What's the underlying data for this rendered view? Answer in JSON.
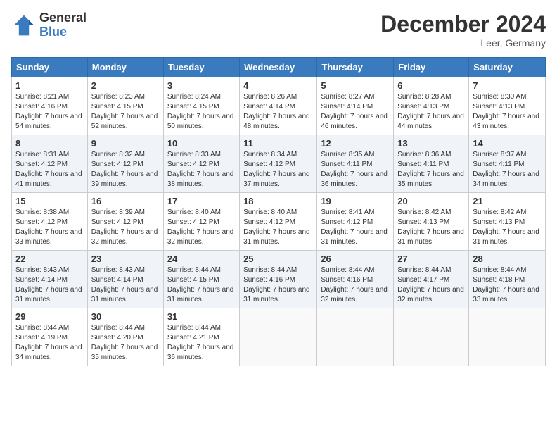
{
  "header": {
    "logo_line1": "General",
    "logo_line2": "Blue",
    "month": "December 2024",
    "location": "Leer, Germany"
  },
  "weekdays": [
    "Sunday",
    "Monday",
    "Tuesday",
    "Wednesday",
    "Thursday",
    "Friday",
    "Saturday"
  ],
  "weeks": [
    [
      {
        "day": "1",
        "sunrise": "8:21 AM",
        "sunset": "4:16 PM",
        "daylight": "7 hours and 54 minutes."
      },
      {
        "day": "2",
        "sunrise": "8:23 AM",
        "sunset": "4:15 PM",
        "daylight": "7 hours and 52 minutes."
      },
      {
        "day": "3",
        "sunrise": "8:24 AM",
        "sunset": "4:15 PM",
        "daylight": "7 hours and 50 minutes."
      },
      {
        "day": "4",
        "sunrise": "8:26 AM",
        "sunset": "4:14 PM",
        "daylight": "7 hours and 48 minutes."
      },
      {
        "day": "5",
        "sunrise": "8:27 AM",
        "sunset": "4:14 PM",
        "daylight": "7 hours and 46 minutes."
      },
      {
        "day": "6",
        "sunrise": "8:28 AM",
        "sunset": "4:13 PM",
        "daylight": "7 hours and 44 minutes."
      },
      {
        "day": "7",
        "sunrise": "8:30 AM",
        "sunset": "4:13 PM",
        "daylight": "7 hours and 43 minutes."
      }
    ],
    [
      {
        "day": "8",
        "sunrise": "8:31 AM",
        "sunset": "4:12 PM",
        "daylight": "7 hours and 41 minutes."
      },
      {
        "day": "9",
        "sunrise": "8:32 AM",
        "sunset": "4:12 PM",
        "daylight": "7 hours and 39 minutes."
      },
      {
        "day": "10",
        "sunrise": "8:33 AM",
        "sunset": "4:12 PM",
        "daylight": "7 hours and 38 minutes."
      },
      {
        "day": "11",
        "sunrise": "8:34 AM",
        "sunset": "4:12 PM",
        "daylight": "7 hours and 37 minutes."
      },
      {
        "day": "12",
        "sunrise": "8:35 AM",
        "sunset": "4:11 PM",
        "daylight": "7 hours and 36 minutes."
      },
      {
        "day": "13",
        "sunrise": "8:36 AM",
        "sunset": "4:11 PM",
        "daylight": "7 hours and 35 minutes."
      },
      {
        "day": "14",
        "sunrise": "8:37 AM",
        "sunset": "4:11 PM",
        "daylight": "7 hours and 34 minutes."
      }
    ],
    [
      {
        "day": "15",
        "sunrise": "8:38 AM",
        "sunset": "4:12 PM",
        "daylight": "7 hours and 33 minutes."
      },
      {
        "day": "16",
        "sunrise": "8:39 AM",
        "sunset": "4:12 PM",
        "daylight": "7 hours and 32 minutes."
      },
      {
        "day": "17",
        "sunrise": "8:40 AM",
        "sunset": "4:12 PM",
        "daylight": "7 hours and 32 minutes."
      },
      {
        "day": "18",
        "sunrise": "8:40 AM",
        "sunset": "4:12 PM",
        "daylight": "7 hours and 31 minutes."
      },
      {
        "day": "19",
        "sunrise": "8:41 AM",
        "sunset": "4:12 PM",
        "daylight": "7 hours and 31 minutes."
      },
      {
        "day": "20",
        "sunrise": "8:42 AM",
        "sunset": "4:13 PM",
        "daylight": "7 hours and 31 minutes."
      },
      {
        "day": "21",
        "sunrise": "8:42 AM",
        "sunset": "4:13 PM",
        "daylight": "7 hours and 31 minutes."
      }
    ],
    [
      {
        "day": "22",
        "sunrise": "8:43 AM",
        "sunset": "4:14 PM",
        "daylight": "7 hours and 31 minutes."
      },
      {
        "day": "23",
        "sunrise": "8:43 AM",
        "sunset": "4:14 PM",
        "daylight": "7 hours and 31 minutes."
      },
      {
        "day": "24",
        "sunrise": "8:44 AM",
        "sunset": "4:15 PM",
        "daylight": "7 hours and 31 minutes."
      },
      {
        "day": "25",
        "sunrise": "8:44 AM",
        "sunset": "4:16 PM",
        "daylight": "7 hours and 31 minutes."
      },
      {
        "day": "26",
        "sunrise": "8:44 AM",
        "sunset": "4:16 PM",
        "daylight": "7 hours and 32 minutes."
      },
      {
        "day": "27",
        "sunrise": "8:44 AM",
        "sunset": "4:17 PM",
        "daylight": "7 hours and 32 minutes."
      },
      {
        "day": "28",
        "sunrise": "8:44 AM",
        "sunset": "4:18 PM",
        "daylight": "7 hours and 33 minutes."
      }
    ],
    [
      {
        "day": "29",
        "sunrise": "8:44 AM",
        "sunset": "4:19 PM",
        "daylight": "7 hours and 34 minutes."
      },
      {
        "day": "30",
        "sunrise": "8:44 AM",
        "sunset": "4:20 PM",
        "daylight": "7 hours and 35 minutes."
      },
      {
        "day": "31",
        "sunrise": "8:44 AM",
        "sunset": "4:21 PM",
        "daylight": "7 hours and 36 minutes."
      },
      null,
      null,
      null,
      null
    ]
  ],
  "labels": {
    "sunrise": "Sunrise:",
    "sunset": "Sunset:",
    "daylight": "Daylight:"
  }
}
